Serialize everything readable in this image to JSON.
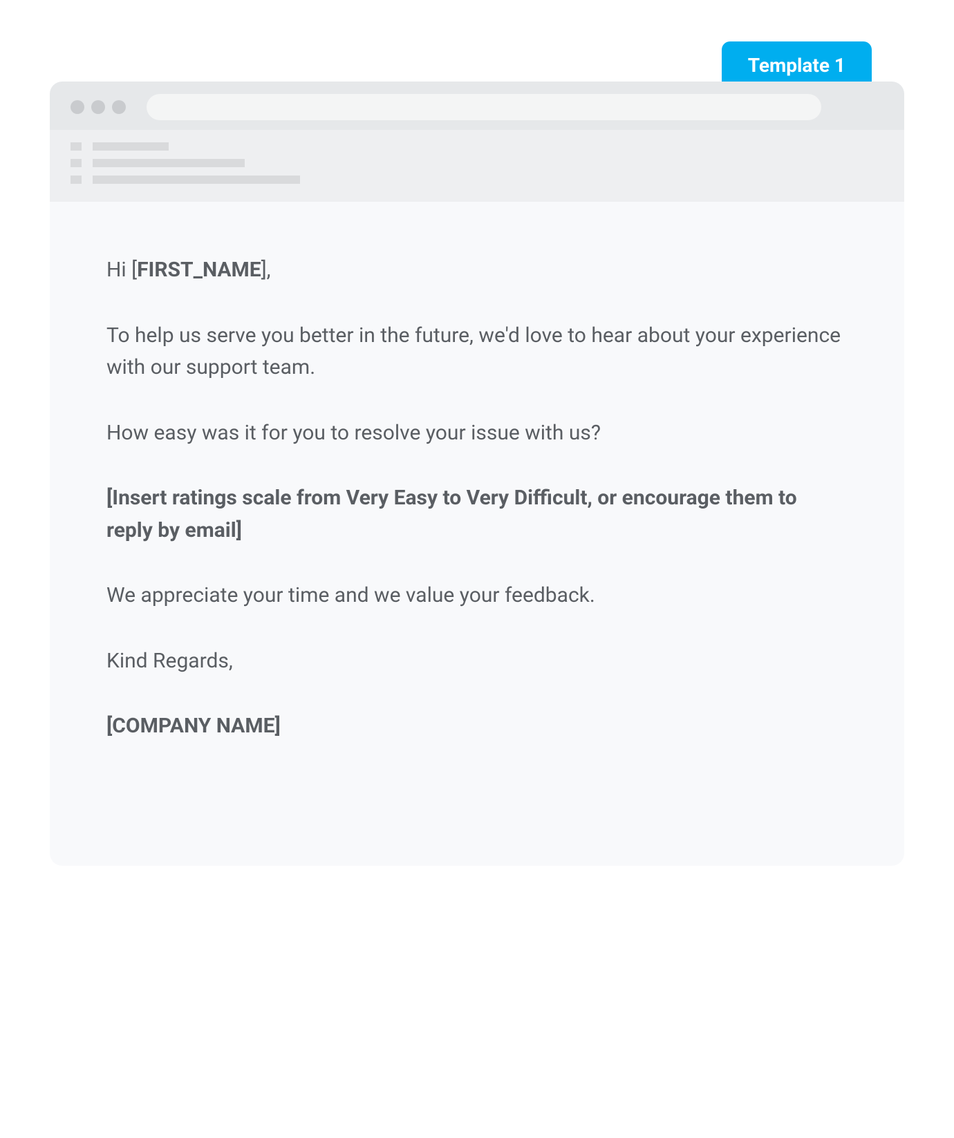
{
  "tab": {
    "label": "Template 1"
  },
  "email": {
    "greeting_prefix": "Hi [",
    "greeting_name": "FIRST_NAME",
    "greeting_suffix": "],",
    "para1": "To help us serve you better in the future, we'd love to hear about your experience with our support team.",
    "para2": "How easy was it for you to resolve your issue with us?",
    "para3": "[Insert ratings scale from Very Easy to Very Difficult, or encourage them to reply by email]",
    "para4": "We appreciate your time and we value your feedback.",
    "signoff": "Kind Regards,",
    "company": "[COMPANY NAME]"
  }
}
